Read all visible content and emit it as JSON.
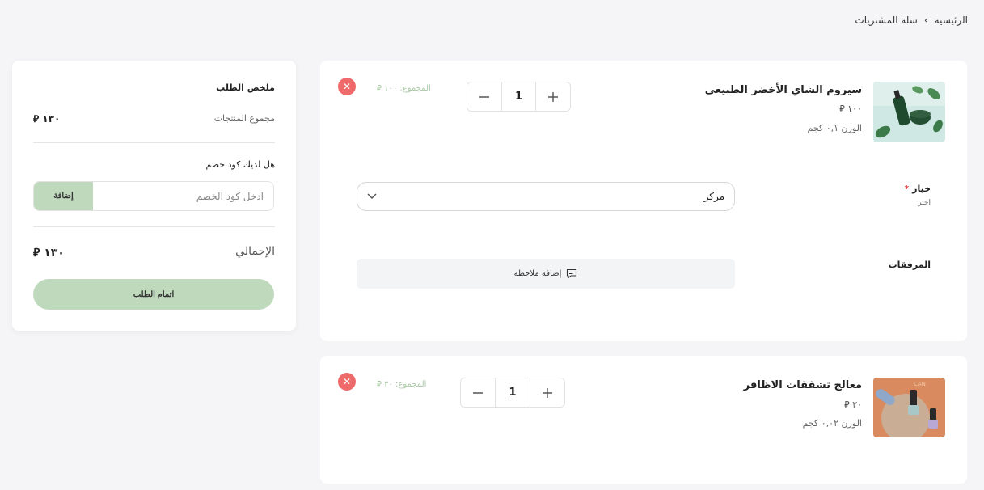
{
  "breadcrumb": {
    "home": "الرئيسية",
    "separator": "›",
    "current": "سلة المشتريات"
  },
  "summary": {
    "title": "ملخص الطلب",
    "products_total_label": "مجموع المنتجات",
    "products_total_value": "١٣٠ ⃁",
    "coupon_question": "هل لديك كود خصم",
    "coupon_placeholder": "ادخل كود الخصم",
    "coupon_button": "إضافة",
    "grand_total_label": "الإجمالي",
    "grand_total_value": "١٣٠ ⃁",
    "checkout_button": "اتمام الطلب"
  },
  "items": [
    {
      "name": "سيروم الشاي الأخضر الطبيعي",
      "price": "١٠٠ ⃁",
      "weight": "الوزن ٠,١ كجم",
      "quantity": "1",
      "line_total": "المجموع: ١٠٠ ⃁",
      "option_label": "خيار",
      "option_required_mark": "*",
      "option_hint": "اختر",
      "option_value": "مركز",
      "attachments_label": "المرفقات",
      "note_button": "إضافة ملاحظة"
    },
    {
      "name": "معالج تشققات الاظافر",
      "price": "٣٠ ⃁",
      "weight": "الوزن ٠,٠٢ كجم",
      "quantity": "1",
      "line_total": "المجموع: ٣٠ ⃁"
    }
  ],
  "colors": {
    "accent": "#bfd9bd",
    "remove": "#ef6b6b",
    "line_total": "#a9c9a5"
  },
  "icons": {
    "remove": "close-icon",
    "plus": "plus-icon",
    "minus": "minus-icon",
    "chevron": "chevron-down-icon",
    "note": "comment-icon"
  }
}
